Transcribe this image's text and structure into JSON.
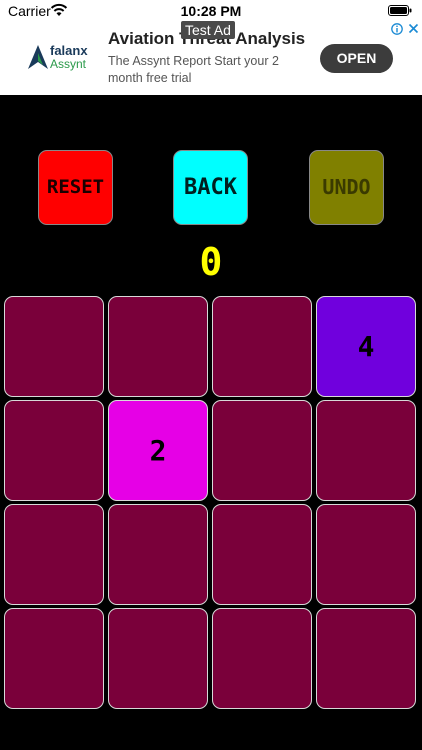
{
  "status_bar": {
    "carrier": "Carrier",
    "time": "10:28 PM",
    "wifi_icon": "wifi-icon",
    "battery_icon": "battery-icon"
  },
  "ad": {
    "label": "Test Ad",
    "brand_top": "falanx",
    "brand_bottom": "Assynt",
    "title": "Aviation Threat Analysis",
    "body": "The Assynt Report Start your 2 month free trial",
    "cta": "OPEN",
    "adchoices_icon": "adchoices-icon",
    "close_icon": "close-icon"
  },
  "controls": {
    "reset_label": "RESET",
    "back_label": "BACK",
    "undo_label": "UNDO"
  },
  "colors": {
    "reset": "#ff0000",
    "back": "#00ffff",
    "undo": "#808000",
    "score": "#ffff00",
    "empty_tile": "#7a003a",
    "tile_2": "#e600e6",
    "tile_4": "#7000dd"
  },
  "score": "0",
  "board": [
    [
      "",
      "",
      "",
      "4"
    ],
    [
      "",
      "2",
      "",
      ""
    ],
    [
      "",
      "",
      "",
      ""
    ],
    [
      "",
      "",
      "",
      ""
    ]
  ]
}
